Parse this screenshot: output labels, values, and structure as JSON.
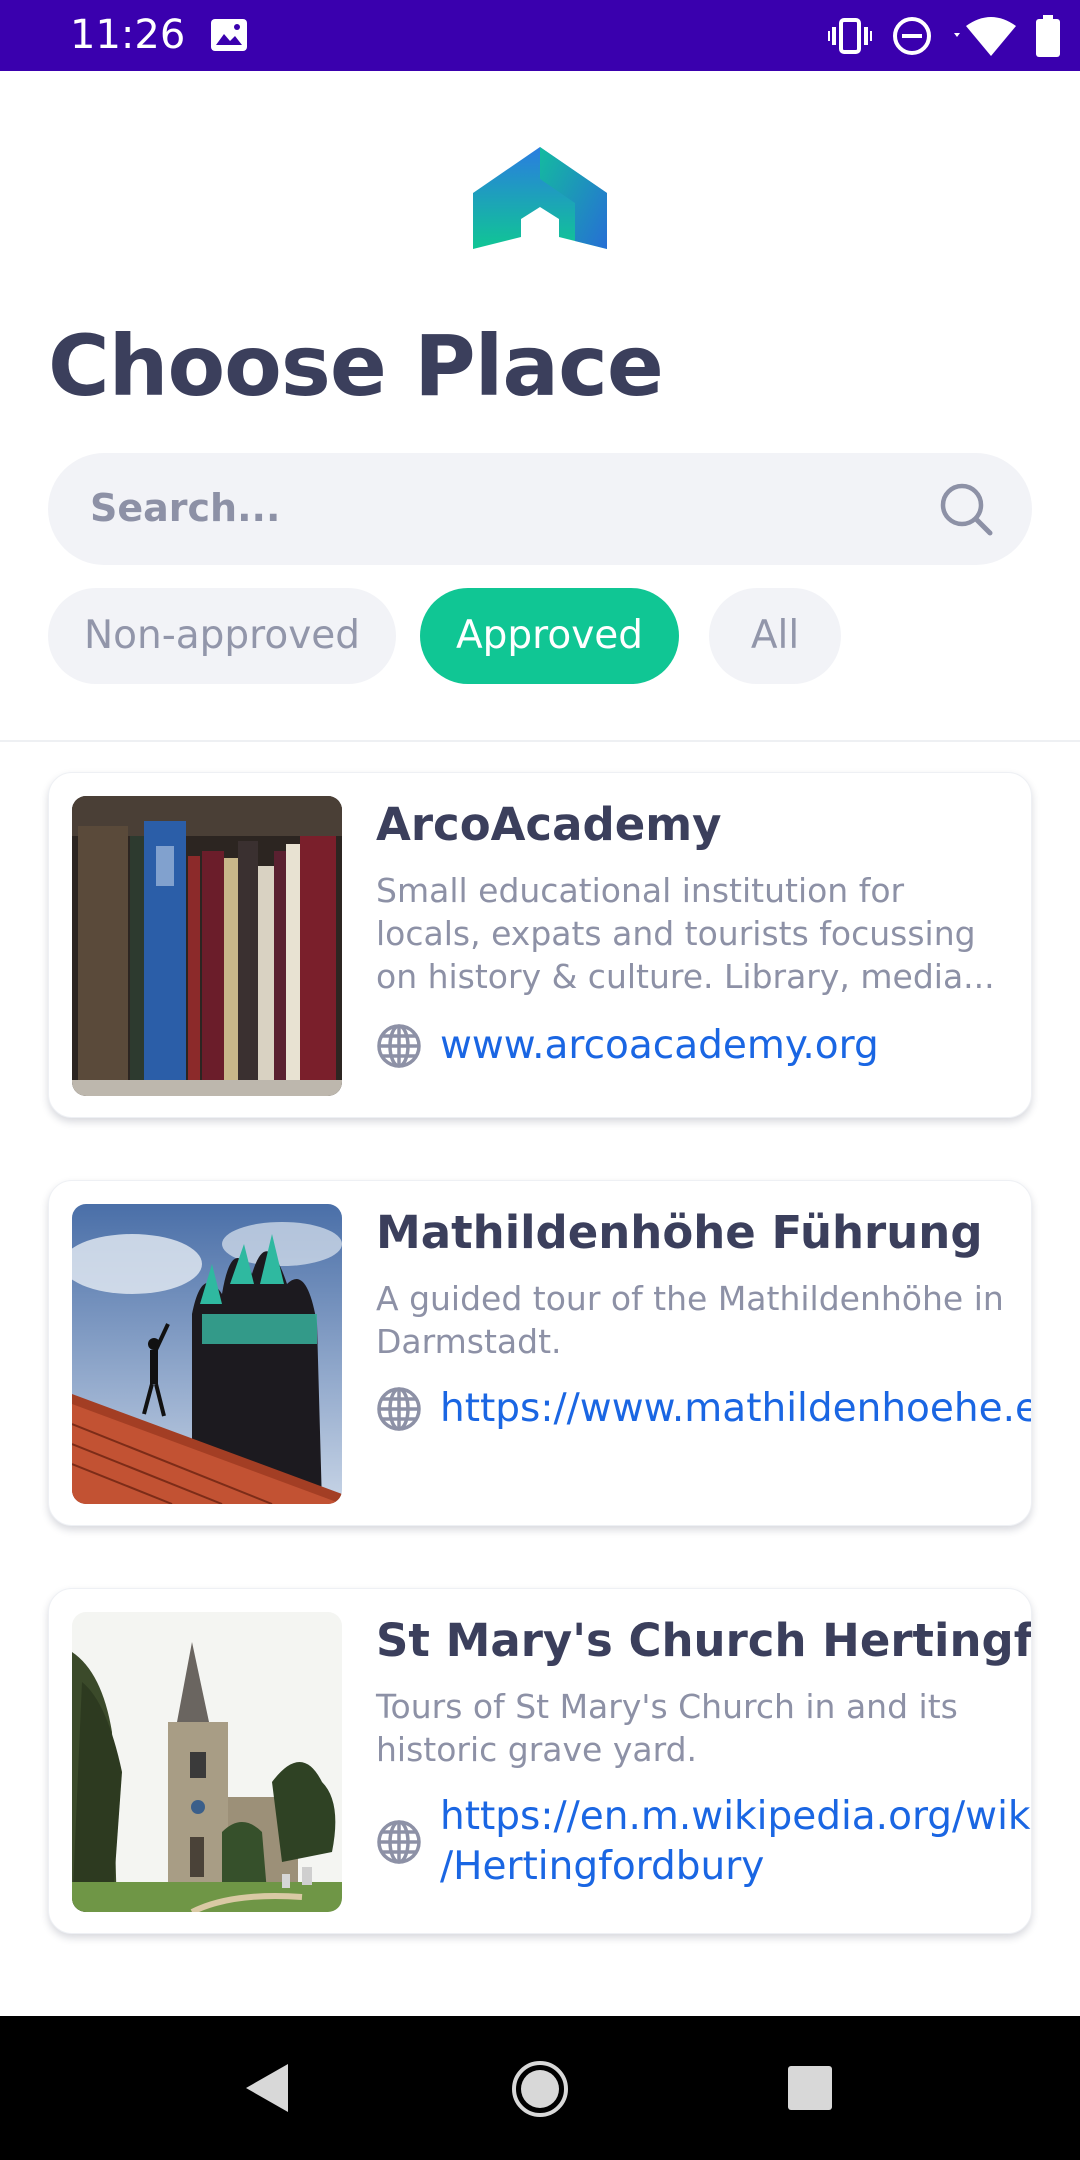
{
  "status_bar": {
    "time": "11:26",
    "icons": [
      "photo-icon",
      "vibrate-icon",
      "do-not-disturb-icon",
      "wifi-icon",
      "battery-icon"
    ],
    "background": "#3a00ae"
  },
  "header": {
    "logo_icon": "house-arrow-logo",
    "title": "Choose Place"
  },
  "search": {
    "placeholder": "Search...",
    "icon": "search-icon"
  },
  "filters": {
    "chips": [
      {
        "label": "Non-approved",
        "selected": false
      },
      {
        "label": "Approved",
        "selected": true
      },
      {
        "label": "All",
        "selected": false
      }
    ],
    "active_color": "#10c694"
  },
  "places": [
    {
      "title": "ArcoAcademy",
      "description": "Small educational institution for locals, expats and tourists focussing on history & culture. Library, media...",
      "url": "www.arcoacademy.org",
      "thumbnail": "bookshelf-photo"
    },
    {
      "title": "Mathildenhöhe Führung",
      "description": "A guided tour of the Mathildenhöhe in Darmstadt.",
      "url": "https://www.mathildenhoehe.eu",
      "thumbnail": "wedding-tower-photo"
    },
    {
      "title": "St Mary's Church Hertingfordbury",
      "description": "Tours of St Mary's Church in and its historic grave yard.",
      "url": "https://en.m.wikipedia.org/wiki/Hertingfordbury",
      "url_line1": "https://en.m.wikipedia.org/wiki",
      "url_line2": "/Hertingfordbury",
      "thumbnail": "church-photo"
    }
  ],
  "nav_bar": {
    "icons": [
      "back-icon",
      "home-icon",
      "recents-icon"
    ]
  }
}
